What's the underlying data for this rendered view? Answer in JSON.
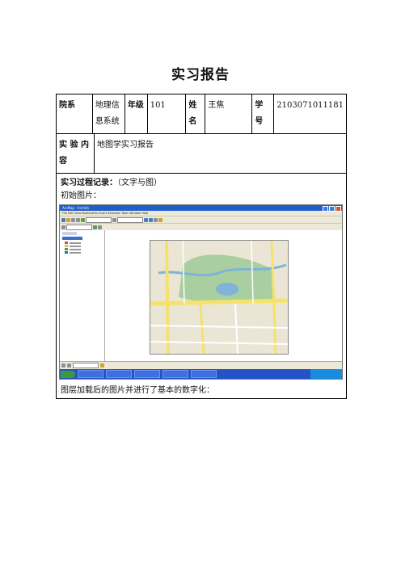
{
  "title": "实习报告",
  "table": {
    "dept_label": "院系",
    "dept_value": "地理信息系统",
    "grade_label": "年级",
    "grade_value": "101",
    "name_label": "姓名",
    "name_value": "王焦",
    "id_label": "学号",
    "id_value": "2103071011181",
    "content_label": "实 验 内 容",
    "content_value": "地图学实习报告",
    "process_label": "实习过程记录：",
    "process_hint": "（文字与图）",
    "initial_caption": "初始图片：",
    "after_caption": "图层加载后的图片并进行了基本的数字化："
  },
  "screenshot": {
    "window_title": "ArcMap - ArcInfo",
    "menu": "File  Edit  View  Bookmarks  Insert  Selection  Tools  Window  Help"
  },
  "colors": {
    "titlebar": "#1f5fc8",
    "taskbar": "#2452c9",
    "map_green": "#a9cfa0",
    "map_road_yellow": "#f4e26a",
    "map_water": "#7fb3d8"
  }
}
